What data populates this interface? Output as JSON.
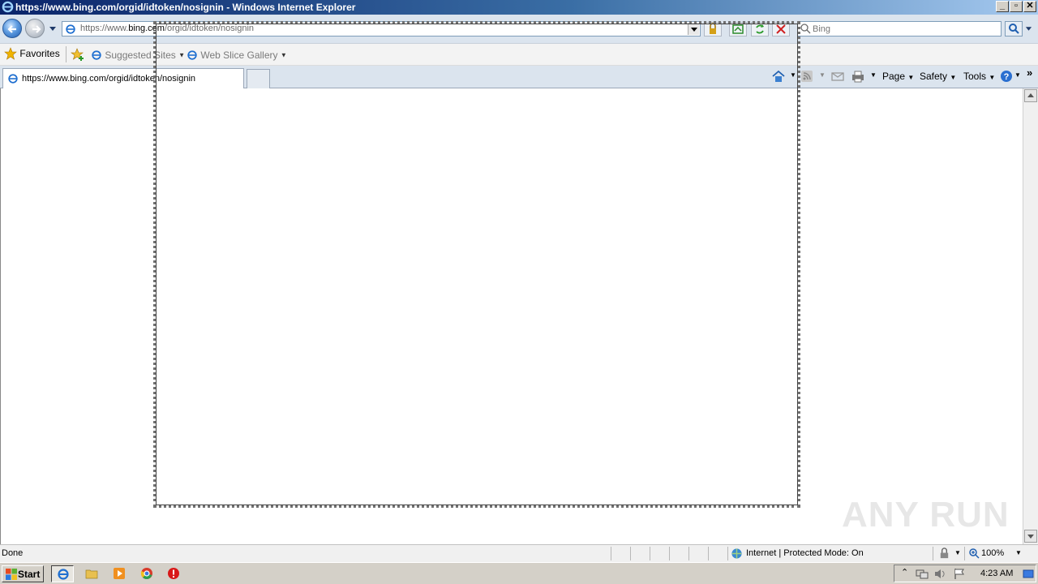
{
  "window": {
    "title": "https://www.bing.com/orgid/idtoken/nosignin - Windows Internet Explorer",
    "controls": {
      "minimize": "_",
      "maximize": "▫",
      "close": "✕"
    }
  },
  "address": {
    "url_scheme": "https://www.",
    "url_domain": "bing.com",
    "url_path": "/orgid/idtoken/nosignin"
  },
  "search": {
    "placeholder": "Bing"
  },
  "favorites": {
    "label": "Favorites",
    "items": [
      {
        "label": "Suggested Sites"
      },
      {
        "label": "Web Slice Gallery"
      }
    ]
  },
  "tabs": [
    {
      "label": "https://www.bing.com/orgid/idtoken/nosignin"
    }
  ],
  "command_bar": {
    "page": "Page",
    "safety": "Safety",
    "tools": "Tools",
    "overflow": "»"
  },
  "status": {
    "text": "Done",
    "zone": "Internet | Protected Mode: On",
    "zoom": "100%"
  },
  "taskbar": {
    "start_label": "Start",
    "clock": "4:23 AM"
  },
  "watermark": {
    "text": "ANY RUN"
  },
  "colors": {
    "chrome_bg": "#dbe4ee",
    "title_gradient_start": "#0a246a",
    "taskbar_bg": "#d4d0c8"
  }
}
